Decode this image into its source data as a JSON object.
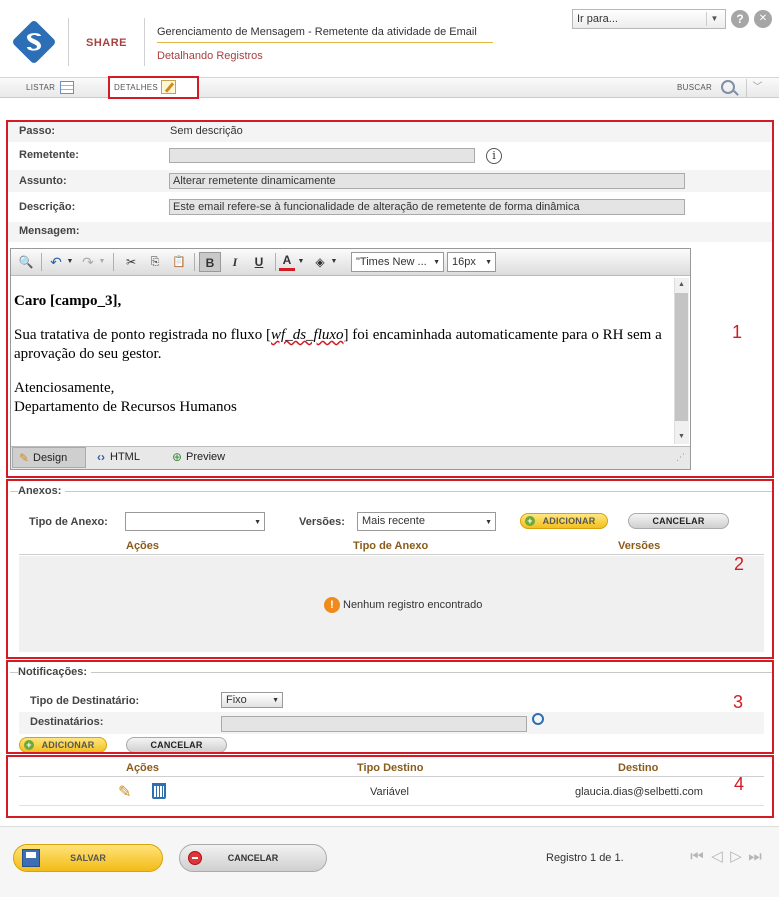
{
  "header": {
    "app_name": "SHARE",
    "title": "Gerenciamento de Mensagem - Remetente da atividade de Email",
    "subtitle": "Detalhando Registros",
    "goto_placeholder": "Ir para...",
    "help_glyph": "?",
    "close_glyph": "✕"
  },
  "tabs": {
    "listar": "LISTAR",
    "detalhes": "DETALHES",
    "buscar": "BUSCAR"
  },
  "form": {
    "passo_label": "Passo:",
    "passo_value": "Sem descrição",
    "remetente_label": "Remetente:",
    "remetente_value": "",
    "assunto_label": "Assunto:",
    "assunto_value": "Alterar remetente dinamicamente",
    "descricao_label": "Descrição:",
    "descricao_value": "Este email refere-se à funcionalidade de alteração de remetente de forma dinâmica",
    "mensagem_label": "Mensagem:"
  },
  "editor": {
    "font_family": "\"Times New ...",
    "font_size": "16px",
    "greeting": "Caro [campo_3],",
    "body_before": "Sua tratativa de ponto registrada no fluxo [",
    "body_var": "wf_ds_fluxo",
    "body_after": "] foi encaminhada automaticamente para o RH sem a aprovação do seu gestor.",
    "closing": "Atenciosamente,",
    "signature": "Departamento de Recursos Humanos",
    "modes": {
      "design": "Design",
      "html": "HTML",
      "preview": "Preview"
    }
  },
  "anexos": {
    "legend": "Anexos:",
    "tipo_label": "Tipo de Anexo:",
    "tipo_value": "",
    "versoes_label": "Versões:",
    "versoes_value": "Mais recente",
    "add_label": "ADICIONAR",
    "cancel_label": "CANCELAR",
    "columns": [
      "Ações",
      "Tipo de Anexo",
      "Versões"
    ],
    "empty_message": "Nenhum registro encontrado"
  },
  "notificacoes": {
    "legend": "Notificações:",
    "tipo_label": "Tipo de Destinatário:",
    "tipo_value": "Fixo",
    "destinatarios_label": "Destinatários:",
    "destinatarios_value": "",
    "add_label": "ADICIONAR",
    "cancel_label": "CANCELAR",
    "columns": [
      "Ações",
      "Tipo Destino",
      "Destino"
    ],
    "rows": [
      {
        "tipo": "Variável",
        "destino": "glaucia.dias@selbetti.com"
      }
    ]
  },
  "annotations": [
    "1",
    "2",
    "3",
    "4"
  ],
  "footer": {
    "save_label": "SALVAR",
    "cancel_label": "CANCELAR",
    "record_text": "Registro 1 de 1."
  },
  "colors": {
    "highlight_red": "#d21b24",
    "brand_red": "#a84040",
    "accent_yellow": "#f2c01d",
    "header_text": "#8a5b1b"
  }
}
